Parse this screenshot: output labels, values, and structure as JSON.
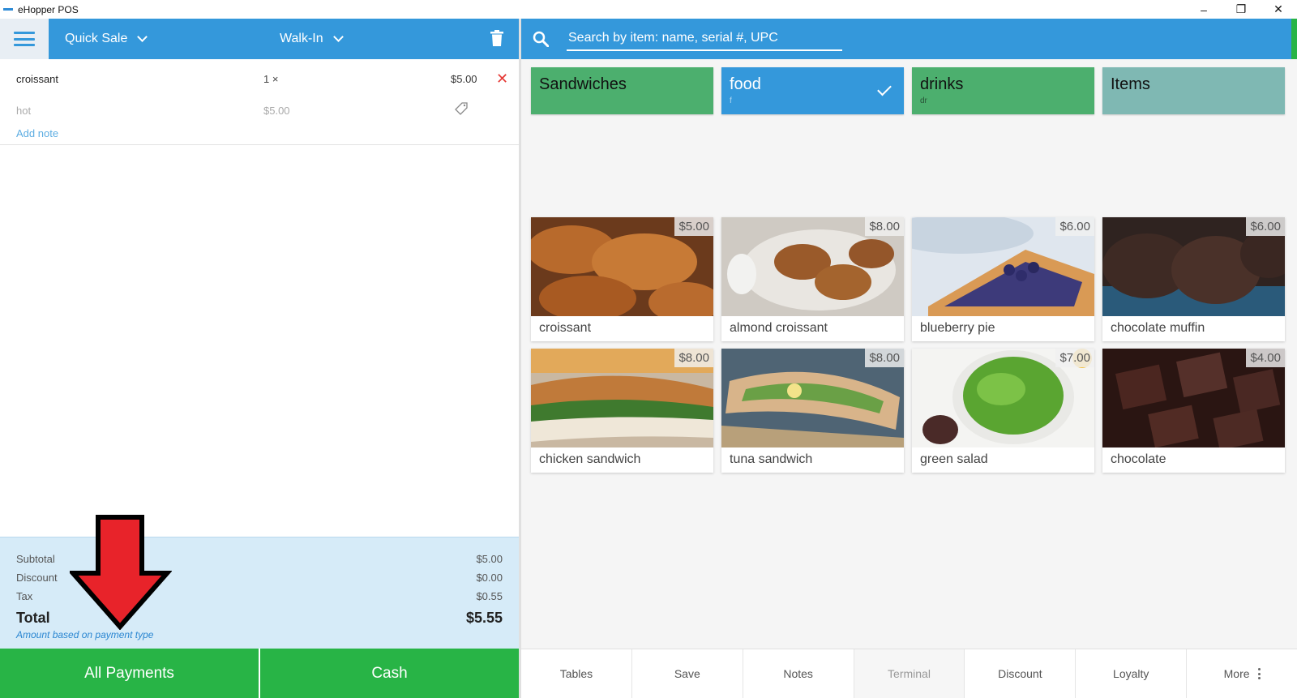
{
  "window": {
    "title": "eHopper POS",
    "controls": {
      "minimize": "–",
      "restore": "❐",
      "close": "✕"
    }
  },
  "left_header": {
    "order_type": "Quick Sale",
    "customer": "Walk-In"
  },
  "ticket": {
    "item_name": "croissant",
    "qty": "1 ×",
    "line_price": "$5.00",
    "modifier": "hot",
    "modifier_price": "$5.00",
    "add_note": "Add note"
  },
  "totals": {
    "subtotal_label": "Subtotal",
    "subtotal": "$5.00",
    "discount_label": "Discount",
    "discount": "$0.00",
    "tax_label": "Tax",
    "tax": "$0.55",
    "total_label": "Total",
    "total": "$5.55",
    "hint": "Amount based on payment type"
  },
  "payments": {
    "all": "All Payments",
    "cash": "Cash"
  },
  "search": {
    "placeholder": "Search by item: name, serial #, UPC"
  },
  "categories": [
    {
      "name": "Sandwiches",
      "sub": "",
      "color": "#4caf6e"
    },
    {
      "name": "food",
      "sub": "f",
      "color": "#3498db"
    },
    {
      "name": "drinks",
      "sub": "dr",
      "color": "#4caf6e"
    },
    {
      "name": "Items",
      "sub": "",
      "color": "#7fb8b3"
    }
  ],
  "products": [
    {
      "name": "croissant",
      "price": "$5.00"
    },
    {
      "name": "almond croissant",
      "price": "$8.00"
    },
    {
      "name": "blueberry pie",
      "price": "$6.00"
    },
    {
      "name": "chocolate muffin",
      "price": "$6.00"
    },
    {
      "name": "chicken sandwich",
      "price": "$8.00"
    },
    {
      "name": "tuna sandwich",
      "price": "$8.00"
    },
    {
      "name": "green salad",
      "price": "$7.00"
    },
    {
      "name": "chocolate",
      "price": "$4.00"
    }
  ],
  "toolbar": {
    "tables": "Tables",
    "save": "Save",
    "notes": "Notes",
    "terminal": "Terminal",
    "discount": "Discount",
    "loyalty": "Loyalty",
    "more": "More"
  },
  "colors": {
    "header_blue": "#3498db",
    "pay_green": "#28b446",
    "totals_bg": "#d6ebf8",
    "remove_red": "#e53935"
  }
}
